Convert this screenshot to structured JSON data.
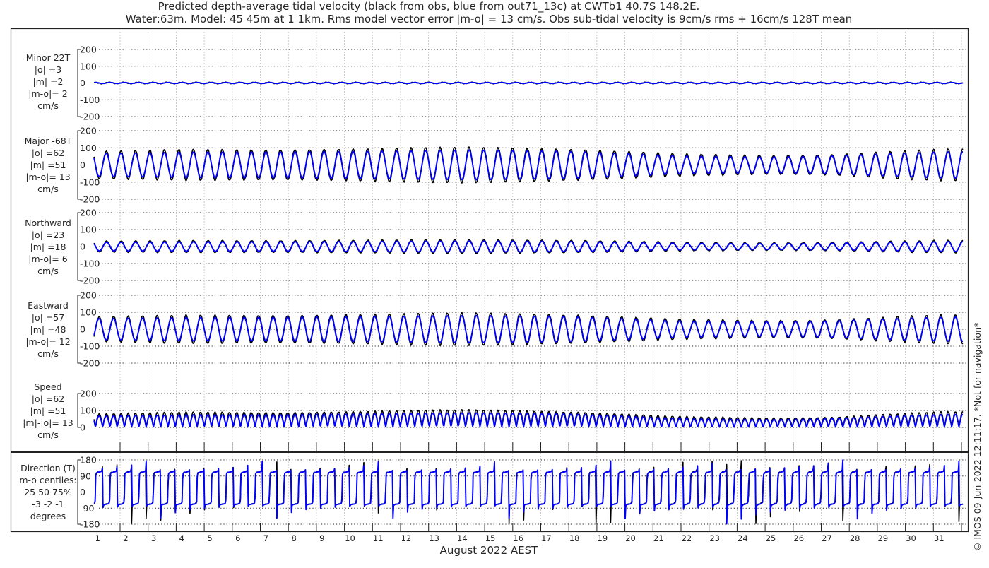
{
  "chart_data": {
    "type": "line",
    "title": [
      "Predicted depth-average tidal velocity (black from obs, blue from out71_13c) at CWTb1 40.7S 148.2E.",
      "Water:63m. Model: 45 45m at 1 1km. Rms model vector error |m-o| = 13 cm/s. Obs sub-tidal velocity is 9cm/s rms + 16cm/s 128T mean"
    ],
    "xlabel": "August 2022 AEST",
    "x_tick_labels": [
      "1",
      "2",
      "3",
      "4",
      "5",
      "6",
      "7",
      "8",
      "9",
      "10",
      "11",
      "12",
      "13",
      "14",
      "15",
      "16",
      "17",
      "18",
      "19",
      "20",
      "21",
      "22",
      "23",
      "24",
      "25",
      "26",
      "27",
      "28",
      "29",
      "30",
      "31"
    ],
    "xlim_days": [
      0,
      31.3
    ],
    "watermark": "© IMOS 09-Jun-2022 12:11:17. *Not for navigation*",
    "series_colors": {
      "obs": "#000000",
      "model": "#0000ff"
    },
    "tide_period_hours": 12.42,
    "major_axis_deg_true": -68,
    "minor_axis_deg_true": 22,
    "daily_major_amplitude_obs": [
      80,
      82,
      85,
      88,
      88,
      88,
      88,
      90,
      92,
      93,
      95,
      98,
      100,
      102,
      100,
      98,
      95,
      90,
      82,
      75,
      65,
      60,
      58,
      55,
      55,
      58,
      62,
      70,
      78,
      85,
      90
    ],
    "daily_major_amplitude_model": [
      68,
      70,
      72,
      75,
      75,
      75,
      75,
      77,
      78,
      79,
      81,
      83,
      85,
      87,
      85,
      83,
      81,
      77,
      70,
      64,
      55,
      51,
      49,
      47,
      47,
      49,
      53,
      60,
      66,
      72,
      77
    ],
    "minor_amplitude_obs": 4,
    "minor_amplitude_model": 3,
    "panels": [
      {
        "id": "minor",
        "labels": [
          "Minor 22T",
          "|o| =3",
          "|m| =2",
          "|m-o|= 2",
          "cm/s"
        ],
        "yticks": [
          200,
          100,
          0,
          -100,
          -200
        ],
        "ylim": [
          -200,
          200
        ]
      },
      {
        "id": "major",
        "labels": [
          "Major -68T",
          "|o| =62",
          "|m| =51",
          "|m-o|= 13",
          "cm/s"
        ],
        "yticks": [
          200,
          100,
          0,
          -100,
          -200
        ],
        "ylim": [
          -200,
          200
        ]
      },
      {
        "id": "north",
        "labels": [
          "Northward",
          "|o| =23",
          "|m| =18",
          "|m-o|= 6",
          "cm/s"
        ],
        "yticks": [
          200,
          100,
          0,
          -100,
          -200
        ],
        "ylim": [
          -200,
          200
        ]
      },
      {
        "id": "east",
        "labels": [
          "Eastward",
          "|o| =57",
          "|m| =48",
          "|m-o|= 12",
          "cm/s"
        ],
        "yticks": [
          200,
          100,
          0,
          -100,
          -200
        ],
        "ylim": [
          -200,
          200
        ]
      },
      {
        "id": "speed",
        "labels": [
          "Speed",
          "|o| =62",
          "|m| =51",
          "|m|-|o|= 13",
          "cm/s"
        ],
        "yticks": [
          200,
          100,
          0
        ],
        "ylim": [
          0,
          200
        ]
      },
      {
        "id": "direction",
        "labels": [
          "Direction (T)",
          "m-o centiles:",
          "25  50  75%",
          "-3 -2 -1",
          "degrees"
        ],
        "yticks": [
          180,
          90,
          0,
          -90,
          -180
        ],
        "ylim": [
          -180,
          180
        ]
      }
    ]
  }
}
